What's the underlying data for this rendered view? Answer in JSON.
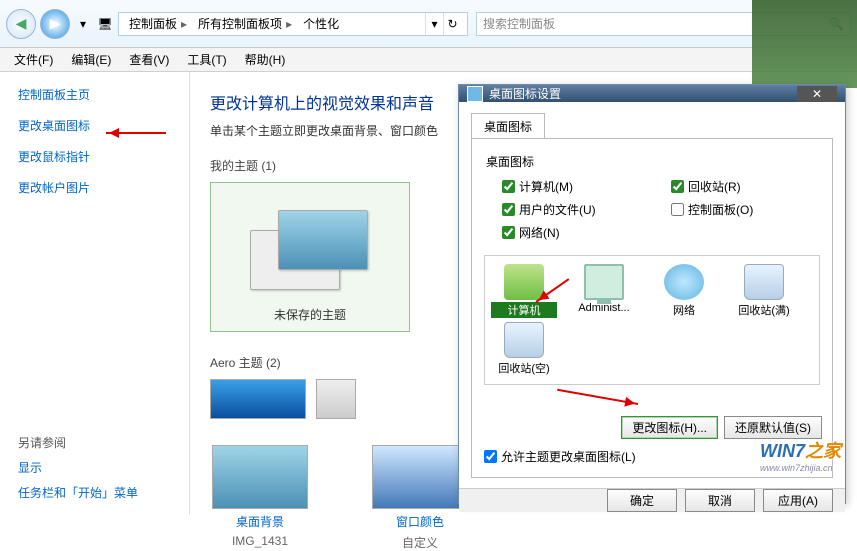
{
  "breadcrumb": {
    "items": [
      "控制面板",
      "所有控制面板项",
      "个性化"
    ]
  },
  "search": {
    "placeholder": "搜索控制面板"
  },
  "menubar": {
    "items": [
      "文件(F)",
      "编辑(E)",
      "查看(V)",
      "工具(T)",
      "帮助(H)"
    ]
  },
  "sidebar": {
    "home": "控制面板主页",
    "links": [
      "更改桌面图标",
      "更改鼠标指针",
      "更改帐户图片"
    ],
    "seealso_label": "另请参阅",
    "seealso": [
      "显示",
      "任务栏和「开始」菜单"
    ]
  },
  "content": {
    "title": "更改计算机上的视觉效果和声音",
    "subtitle": "单击某个主题立即更改桌面背景、窗口颜色",
    "my_themes_label": "我的主题 (1)",
    "unsaved_theme": "未保存的主题",
    "aero_label": "Aero 主题 (2)",
    "tiles": [
      {
        "title": "桌面背景",
        "sub": "IMG_1431"
      },
      {
        "title": "窗口颜色",
        "sub": "自定义"
      }
    ]
  },
  "dialog": {
    "title": "桌面图标设置",
    "tab": "桌面图标",
    "group_label": "桌面图标",
    "checks": [
      {
        "label": "计算机(M)",
        "checked": true
      },
      {
        "label": "回收站(R)",
        "checked": true
      },
      {
        "label": "用户的文件(U)",
        "checked": true
      },
      {
        "label": "控制面板(O)",
        "checked": false
      },
      {
        "label": "网络(N)",
        "checked": true
      }
    ],
    "icons": [
      "计算机",
      "Administ...",
      "网络",
      "回收站(满)",
      "回收站(空)"
    ],
    "selected_icon_index": 0,
    "change_icon": "更改图标(H)...",
    "restore_default": "还原默认值(S)",
    "allow_themes": "允许主题更改桌面图标(L)",
    "ok": "确定",
    "cancel": "取消",
    "apply": "应用(A)"
  },
  "watermark": {
    "brand": "WIN7",
    "suffix": "之家",
    "url": "www.win7zhijia.cn"
  }
}
